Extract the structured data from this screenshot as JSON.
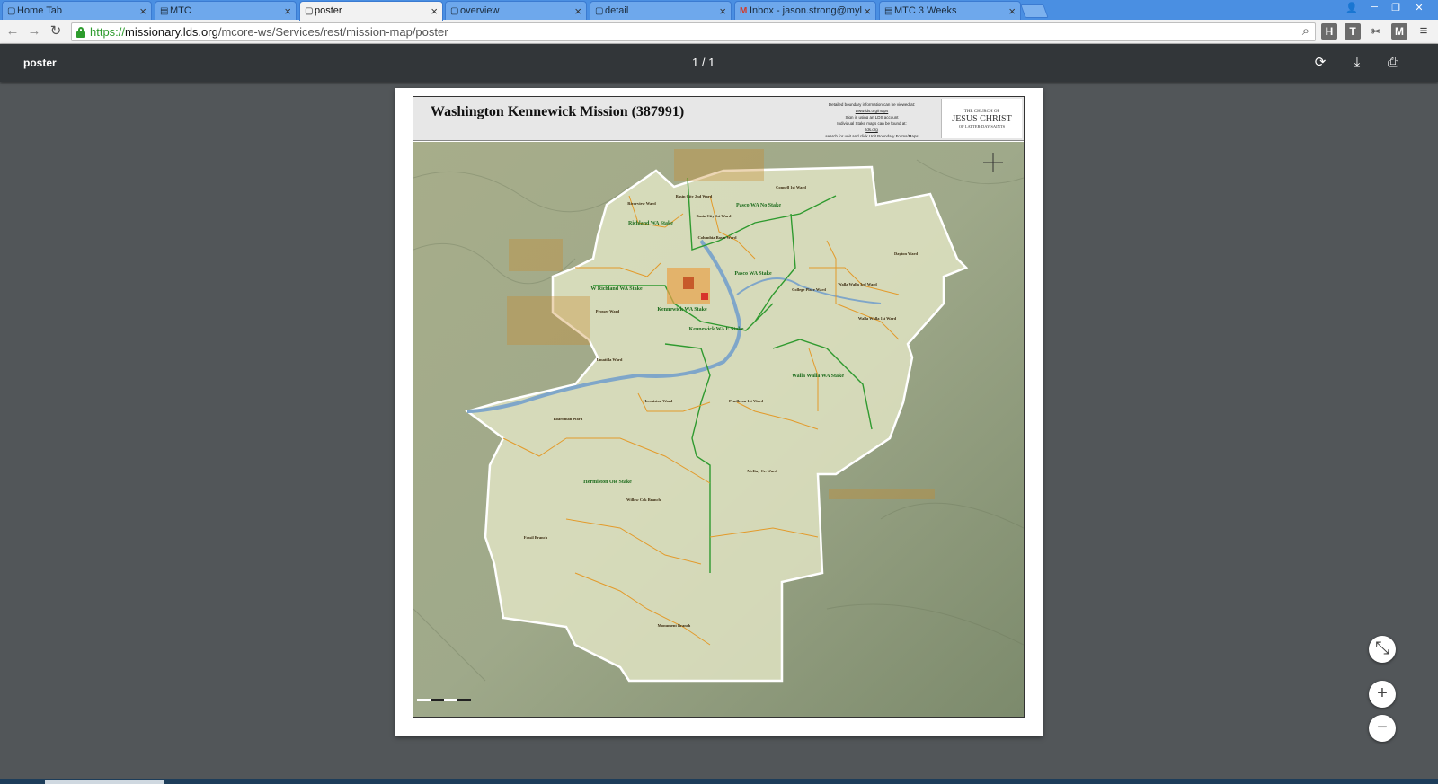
{
  "tabs": [
    {
      "label": "Home Tab",
      "icon": "page-icon",
      "active": false
    },
    {
      "label": "MTC",
      "icon": "mtc-icon",
      "active": false
    },
    {
      "label": "poster",
      "icon": "page-icon",
      "active": true
    },
    {
      "label": "overview",
      "icon": "page-icon",
      "active": false
    },
    {
      "label": "detail",
      "icon": "page-icon",
      "active": false
    },
    {
      "label": "Inbox - jason.strong@myl",
      "icon": "gmail-icon",
      "active": false
    },
    {
      "label": "MTC 3 Weeks",
      "icon": "mtc-icon",
      "active": false
    }
  ],
  "omnibox": {
    "scheme": "https://",
    "host": "missionary.lds.org",
    "path": "/mcore-ws/Services/rest/mission-map/poster"
  },
  "extensions": [
    "H",
    "T",
    "M"
  ],
  "pdf": {
    "title": "poster",
    "page_indicator": "1 / 1"
  },
  "poster": {
    "title": "Washington Kennewick Mission (387991)",
    "info_lines": [
      "Detailed boundary information can be viewed at:",
      "www.lds.org/maps",
      "Sign in using an LDS account",
      "Individual Stake maps can be found at:",
      "lds.org",
      "search for unit and click Unit Boundary Forms/Maps"
    ],
    "logo": {
      "line1": "THE CHURCH OF",
      "line2": "JESUS CHRIST",
      "line3": "OF LATTER-DAY SAINTS"
    },
    "map_labels": [
      "Richland WA Stake",
      "W Richland WA Stake",
      "Kennewick WA Stake",
      "Kennewick WA E Stake",
      "Pasco WA Stake",
      "Pasco WA No Stake",
      "Walla Walla WA Stake",
      "Hermiston OR Stake"
    ],
    "ward_labels": [
      "Riverview Ward",
      "Basin City 2nd Ward",
      "Basin City 1st Ward",
      "Columbia Basin Ward",
      "Connell 1st Ward",
      "Dayton Ward",
      "Walla Walla 3rd Ward",
      "Walla Walla 1st Ward",
      "College Place Ward",
      "Prosser Ward",
      "Umatilla Ward",
      "Hermiston Ward",
      "Boardman Ward",
      "Pendleton 1st Ward",
      "McKay Cr. Ward",
      "Willow Crk Branch",
      "Fossil Branch",
      "Monument Branch"
    ]
  },
  "colors": {
    "tabstrip": "#4a8fe2",
    "pdfbar": "#323639",
    "viewer_bg": "#525659",
    "stake_boundary": "#2f9a2f",
    "ward_boundary": "#e39a2a",
    "mission_fill": "#dfe3c2"
  }
}
